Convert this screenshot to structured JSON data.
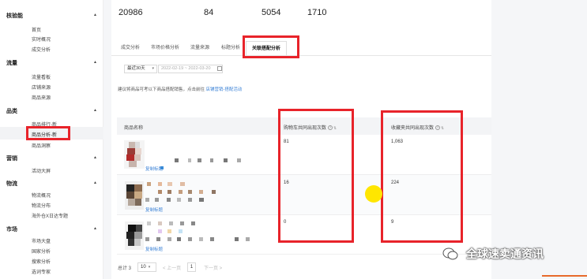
{
  "sidebar": {
    "groups": [
      {
        "label": "核验能",
        "items": [
          "首页",
          "实时概况",
          "成交分析"
        ]
      },
      {
        "label": "流量",
        "items": [
          "流量看板",
          "店铺来源",
          "商品来源"
        ]
      },
      {
        "label": "品类",
        "items": [
          "商品排行-新",
          "商品分析-新",
          "商品洞察"
        ]
      },
      {
        "label": "营销",
        "items": [
          "活动大屏"
        ]
      },
      {
        "label": "物流",
        "items": [
          "物流概况",
          "物流分布",
          "海外仓X日达专题"
        ]
      },
      {
        "label": "市场",
        "items": [
          "市场大盘",
          "国家分析",
          "搜索分析",
          "选词专家"
        ]
      }
    ],
    "active_item": "商品分析-新"
  },
  "stats": [
    "20986",
    "84",
    "5054",
    "1710"
  ],
  "tabs": [
    "成交分析",
    "市场价格分析",
    "流量来源",
    "标题分析",
    "关联搭配分析"
  ],
  "active_tab": "关联搭配分析",
  "filters": {
    "period": "最近30天",
    "date_range": "2022-02-19 ~ 2022-03-20"
  },
  "tip": {
    "text": "建议将商品可考以下商品搭配销售，点击前往",
    "link": "店铺营销-搭配活动"
  },
  "table": {
    "headers": [
      "商品名称",
      "购物车共同出现次数",
      "收藏夹共同出现次数"
    ],
    "rows": [
      {
        "cart": "81",
        "fav": "1,063",
        "copy": "复制标题"
      },
      {
        "cart": "16",
        "fav": "224",
        "copy": "复制标题"
      },
      {
        "cart": "0",
        "fav": "9",
        "copy": "复制标题"
      }
    ]
  },
  "pager": {
    "total_prefix": "总计 3",
    "page_size": "10",
    "prev": "< 上一页",
    "page": "1",
    "next": "下一页 >"
  },
  "watermark": "全球速卖通资讯",
  "colors": {
    "highlight_box": "#e8232a",
    "link": "#3b82d6",
    "cursor_dot": "#ffe600"
  }
}
